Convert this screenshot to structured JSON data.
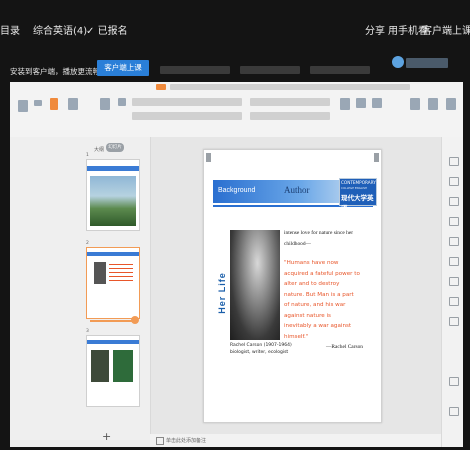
{
  "topbar": {
    "catalog": "目录",
    "course": "综合英语(4)",
    "check": "✓",
    "signed": "已报名",
    "share": "分享",
    "feedback": "用手机看",
    "client": "客户端上课"
  },
  "notice": {
    "text": "安装到客户端，播放更流畅",
    "button": "客户端上课"
  },
  "left_panel": {
    "tab_outline": "大纲",
    "tab_slides": "幻灯片",
    "add": "+"
  },
  "slide": {
    "header_left": "Background",
    "header_center": "Author",
    "logo_top": "CONTEMPORARY",
    "logo_small": "COLLEGE ENGLISH",
    "logo_bottom": "现代大学英语",
    "vertical_title": "Her Life",
    "intro_line1": "intense love for nature since  her",
    "intro_line2": "childhood—",
    "quote": "\"Humans have now acquired a fateful power to alter and to destroy nature. But Man is a part of nature, and his war against nature is inevitably a war against himself.\"",
    "attribution": "—Rachel Carson",
    "caption_line1": "Rachel Carson (1907-1964)",
    "caption_line2": "biologist, writer, ecologist"
  },
  "status": {
    "notes": "单击此处添加备注"
  },
  "colors": {
    "accent": "#2a7fd8",
    "quote": "#e8562a",
    "vertical_title": "#1b5faa",
    "selected_thumb": "#f29b55"
  }
}
